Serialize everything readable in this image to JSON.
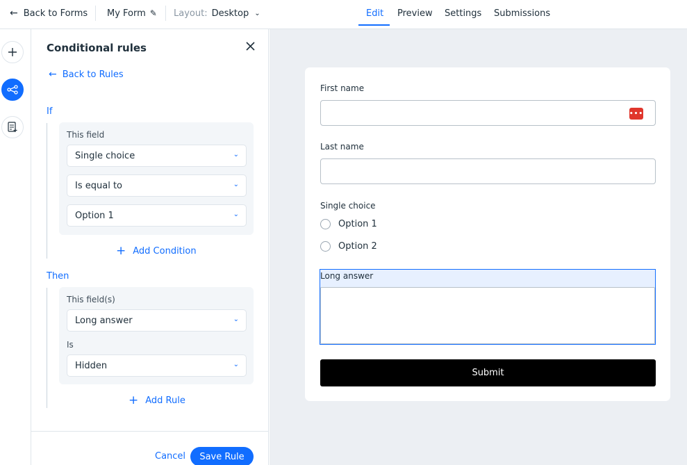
{
  "topbar": {
    "back_label": "Back to Forms",
    "form_name": "My Form",
    "layout_label": "Layout:",
    "layout_value": "Desktop",
    "tabs": [
      {
        "label": "Edit",
        "active": true
      },
      {
        "label": "Preview",
        "active": false
      },
      {
        "label": "Settings",
        "active": false
      },
      {
        "label": "Submissions",
        "active": false
      }
    ]
  },
  "rail": {
    "items": [
      {
        "icon": "plus-icon",
        "active": false
      },
      {
        "icon": "conditional-rules-icon",
        "active": true
      },
      {
        "icon": "add-page-icon",
        "active": false
      }
    ]
  },
  "panel": {
    "title": "Conditional rules",
    "back_label": "Back to Rules",
    "if_label": "If",
    "condition": {
      "field_label": "This field",
      "field_value": "Single choice",
      "operator_value": "Is equal to",
      "value_value": "Option 1"
    },
    "add_condition_label": "Add Condition",
    "then_label": "Then",
    "action": {
      "fields_label": "This field(s)",
      "fields_value": "Long answer",
      "is_label": "Is",
      "state_value": "Hidden"
    },
    "add_rule_label": "Add Rule",
    "cancel_label": "Cancel",
    "save_label": "Save Rule"
  },
  "form": {
    "first_name_label": "First name",
    "last_name_label": "Last name",
    "single_choice_label": "Single choice",
    "options": [
      "Option 1",
      "Option 2"
    ],
    "long_answer_label": "Long answer",
    "submit_label": "Submit"
  },
  "colors": {
    "accent": "#116dff",
    "canvas_bg": "#eceff3",
    "submit_bg": "#000000",
    "autofill_icon": "#e0362c"
  }
}
